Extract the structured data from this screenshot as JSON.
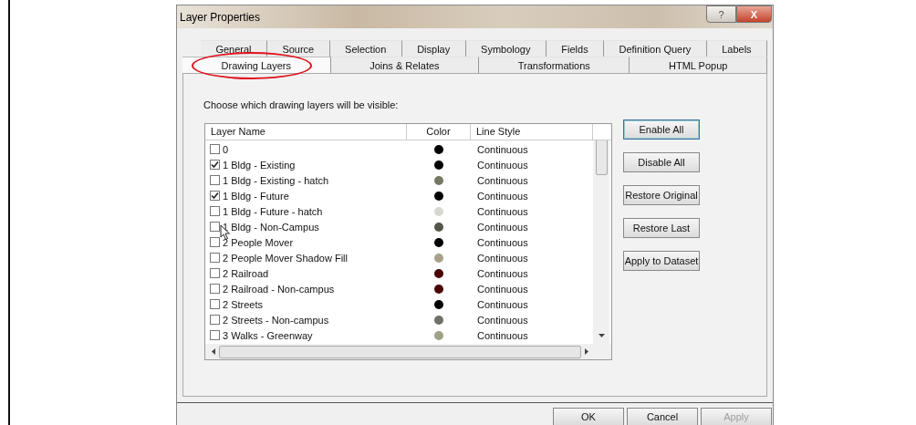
{
  "window": {
    "title": "Layer Properties"
  },
  "title_buttons": [
    {
      "kind": "help",
      "label": "?"
    },
    {
      "kind": "close",
      "label": "X"
    }
  ],
  "tab_rows": [
    {
      "tabs": [
        {
          "label": "General",
          "selected": false,
          "circled": false
        },
        {
          "label": "Source",
          "selected": false,
          "circled": false
        },
        {
          "label": "Selection",
          "selected": false,
          "circled": false
        },
        {
          "label": "Display",
          "selected": false,
          "circled": false
        },
        {
          "label": "Symbology",
          "selected": false,
          "circled": false
        },
        {
          "label": "Fields",
          "selected": false,
          "circled": false
        },
        {
          "label": "Definition Query",
          "selected": false,
          "circled": false
        },
        {
          "label": "Labels",
          "selected": false,
          "circled": false
        }
      ]
    },
    {
      "tabs": [
        {
          "label": "Drawing Layers",
          "selected": true,
          "circled": true
        },
        {
          "label": "Joins & Relates",
          "selected": false,
          "circled": false
        },
        {
          "label": "Transformations",
          "selected": false,
          "circled": false
        },
        {
          "label": "HTML Popup",
          "selected": false,
          "circled": false
        }
      ]
    }
  ],
  "instruction": "Choose which drawing layers will be visible:",
  "table": {
    "columns": [
      "Layer Name",
      "Color",
      "Line Style"
    ],
    "rows": [
      {
        "name": "0",
        "checked": false,
        "color": "#000000",
        "line_style": "Continuous"
      },
      {
        "name": "1 Bldg - Existing",
        "checked": true,
        "color": "#000000",
        "line_style": "Continuous"
      },
      {
        "name": "1 Bldg - Existing - hatch",
        "checked": false,
        "color": "#777766",
        "line_style": "Continuous"
      },
      {
        "name": "1 Bldg - Future",
        "checked": true,
        "color": "#000000",
        "line_style": "Continuous"
      },
      {
        "name": "1 Bldg - Future - hatch",
        "checked": false,
        "color": "#d8d8d0",
        "line_style": "Continuous"
      },
      {
        "name": "1 Bldg - Non-Campus",
        "checked": false,
        "color": "#555548",
        "line_style": "Continuous"
      },
      {
        "name": "2 People Mover",
        "checked": false,
        "color": "#000000",
        "line_style": "Continuous"
      },
      {
        "name": "2 People Mover Shadow Fill",
        "checked": false,
        "color": "#a8a088",
        "line_style": "Continuous"
      },
      {
        "name": "2 Railroad",
        "checked": false,
        "color": "#4a0000",
        "line_style": "Continuous"
      },
      {
        "name": "2 Railroad - Non-campus",
        "checked": false,
        "color": "#4a0000",
        "line_style": "Continuous"
      },
      {
        "name": "2 Streets",
        "checked": false,
        "color": "#000000",
        "line_style": "Continuous"
      },
      {
        "name": "2 Streets - Non-campus",
        "checked": false,
        "color": "#707068",
        "line_style": "Continuous"
      },
      {
        "name": "3 Walks - Greenway",
        "checked": false,
        "color": "#a0a088",
        "line_style": "Continuous"
      }
    ]
  },
  "side_buttons": [
    {
      "label": "Enable All",
      "default": true
    },
    {
      "label": "Disable All",
      "default": false
    },
    {
      "label": "Restore Original",
      "default": false
    },
    {
      "label": "Restore Last",
      "default": false
    },
    {
      "label": "Apply to Dataset",
      "default": false
    }
  ],
  "footer_buttons": [
    {
      "label": "OK",
      "disabled": false
    },
    {
      "label": "Cancel",
      "disabled": false
    },
    {
      "label": "Apply",
      "disabled": true
    }
  ]
}
